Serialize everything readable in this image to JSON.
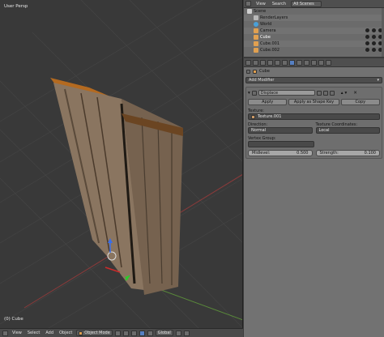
{
  "viewport": {
    "view_label": "User Persp",
    "object_label": "(0) Cube"
  },
  "header3d": {
    "menus": [
      "View",
      "Select",
      "Add",
      "Object"
    ],
    "mode": "Object Mode",
    "orientation": "Global"
  },
  "outliner": {
    "menu_view": "View",
    "menu_search": "Search",
    "scenes_select": "All Scenes",
    "items": [
      {
        "label": "Scene",
        "icon_color": "#cfcfcf"
      },
      {
        "label": "RenderLayers",
        "icon_color": "#b9b9b9"
      },
      {
        "label": "World",
        "icon_color": "#4aa0d8"
      },
      {
        "label": "Camera",
        "icon_color": "#e0a050"
      },
      {
        "label": "Cube",
        "icon_color": "#e0a050"
      },
      {
        "label": "Cube.001",
        "icon_color": "#e0a050"
      },
      {
        "label": "Cube.002",
        "icon_color": "#e0a050"
      }
    ]
  },
  "properties": {
    "context_label": "Cube",
    "add_modifier": "Add Modifier",
    "modifier_name": "Displace",
    "apply": "Apply",
    "apply_shape": "Apply as Shape Key",
    "copy": "Copy",
    "texture_label": "Texture:",
    "texture_value": "Texture.001",
    "direction_label": "Direction:",
    "direction_value": "Normal",
    "coords_label": "Texture Coordinates:",
    "coords_value": "Local",
    "vgroup_label": "Vertex Group:",
    "midlevel_label": "Midlevel:",
    "midlevel_value": "0.500",
    "strength_label": "Strength:",
    "strength_value": "0.100"
  },
  "colors": {
    "accent": "#5680c2",
    "viewport_bg": "#393939",
    "panel_bg": "#727272"
  }
}
